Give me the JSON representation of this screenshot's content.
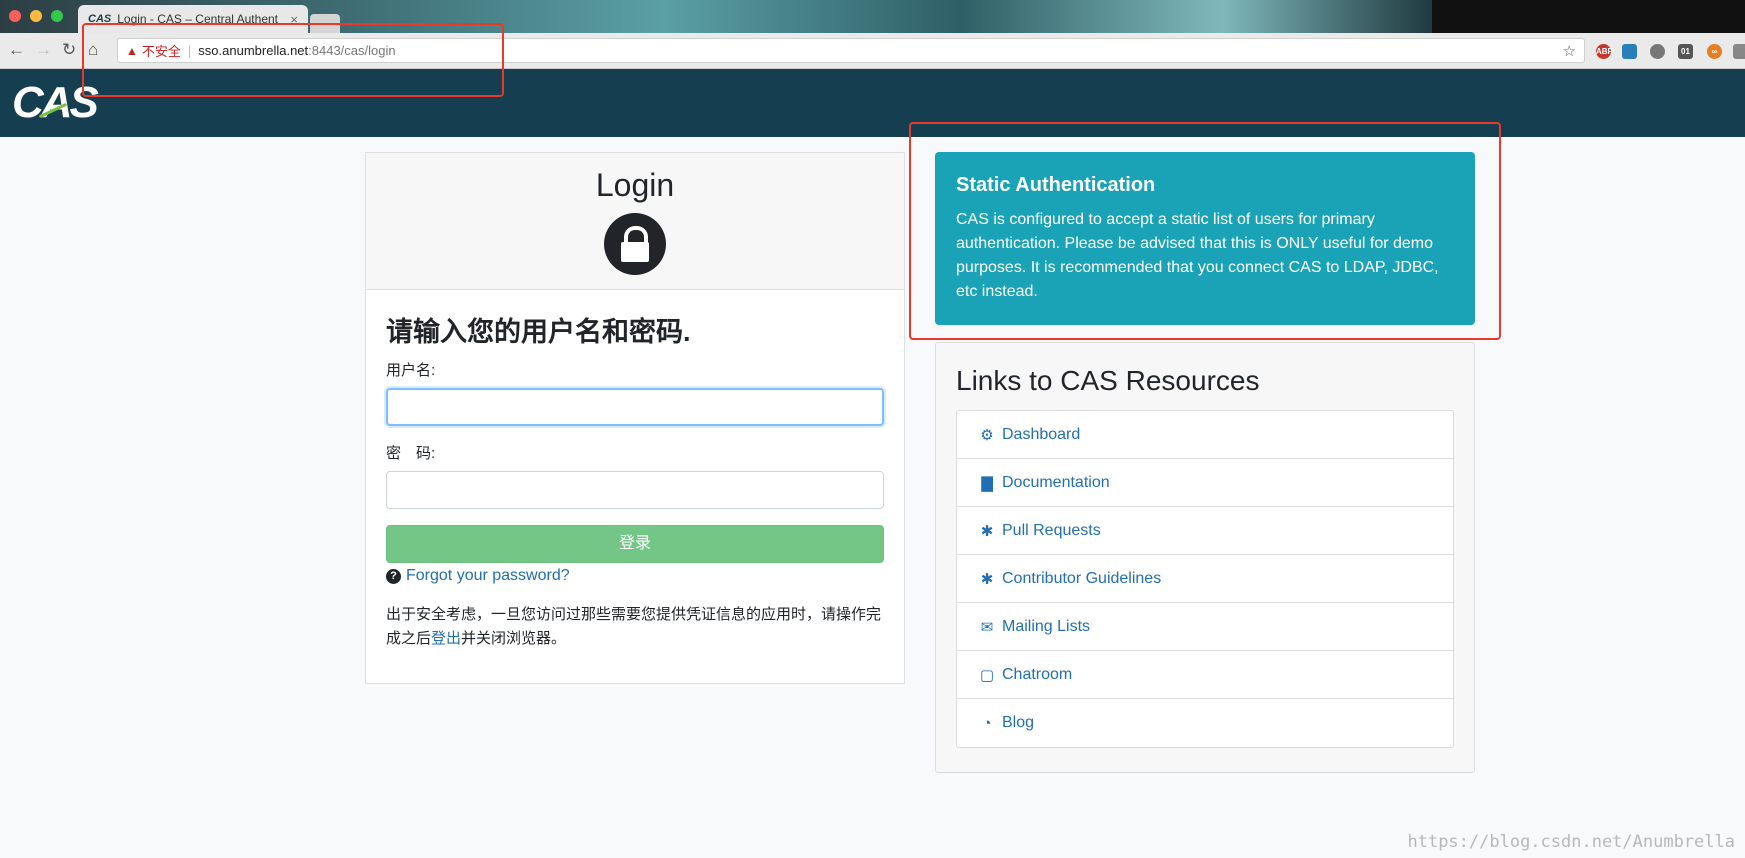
{
  "browser": {
    "tab_favicon": "CAS",
    "tab_title": "Login - CAS – Central Authent",
    "tab_close": "×",
    "back_icon": "arrow-left-icon",
    "forward_icon": "arrow-right-icon",
    "reload_icon": "reload-icon",
    "home_icon": "home-icon",
    "url_insecure_label": "不安全",
    "url_host": "sso.anumbrella.net",
    "url_path": ":8443/cas/login",
    "bookmark_icon": "star-icon",
    "extensions": [
      "ABP",
      "",
      "",
      "01",
      "∞",
      ""
    ]
  },
  "header": {
    "logo_text": "CAS",
    "background": "#153e50"
  },
  "login": {
    "title": "Login",
    "heading": "请输入您的用户名和密码.",
    "username_label": "用户名:",
    "username_value": "",
    "password_label": "密　码:",
    "password_value": "",
    "submit_label": "登录",
    "forgot_label": "Forgot your password?",
    "notice_before": "出于安全考虑，一旦您访问过那些需要您提供凭证信息的应用时，请操作完成之后",
    "notice_link": "登出",
    "notice_after": "并关闭浏览器。"
  },
  "alert": {
    "title": "Static Authentication",
    "text": "CAS is configured to accept a static list of users for primary authentication. Please be advised that this is ONLY useful for demo purposes. It is recommended that you connect CAS to LDAP, JDBC, etc instead.",
    "background": "#1aa3b6"
  },
  "resources": {
    "title": "Links to CAS Resources",
    "items": [
      {
        "label": "Dashboard",
        "icon": "cogs-icon"
      },
      {
        "label": "Documentation",
        "icon": "file-icon"
      },
      {
        "label": "Pull Requests",
        "icon": "bug-icon"
      },
      {
        "label": "Contributor Guidelines",
        "icon": "bug-icon"
      },
      {
        "label": "Mailing Lists",
        "icon": "envelope-icon"
      },
      {
        "label": "Chatroom",
        "icon": "comment-icon"
      },
      {
        "label": "Blog",
        "icon": "rss-icon"
      }
    ]
  },
  "watermark": "https://blog.csdn.net/Anumbrella",
  "colors": {
    "link": "#1f6fb2",
    "submit": "#74c687",
    "annotation": "#e8392b"
  }
}
